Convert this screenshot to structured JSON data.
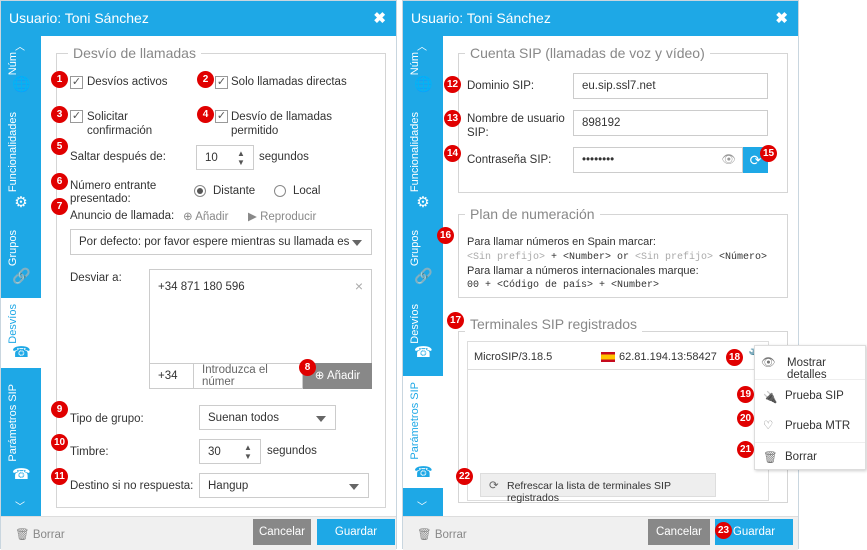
{
  "left": {
    "title": "Usuario: Toni Sánchez",
    "tabs": [
      "Núm",
      "Funcionalidades",
      "Grupos",
      "Desvíos",
      "Parámetros SIP"
    ],
    "legend": "Desvío de llamadas",
    "desvios_activos": "Desvíos activos",
    "solo_directas": "Solo llamadas directas",
    "solicitar": "Solicitar confirmación",
    "desvio_permitido": "Desvío de llamadas permitido",
    "saltar_label": "Saltar después de:",
    "saltar_value": "10",
    "saltar_unit": "segundos",
    "numero_entrante": "Número entrante presentado:",
    "distante": "Distante",
    "local": "Local",
    "anuncio": "Anuncio de llamada:",
    "anadir": "Añadir",
    "reproducir": "Reproducir",
    "anuncio_select": "Por defecto: por favor espere mientras su llamada est",
    "desviar": "Desviar a:",
    "desviar_item": "+34 871 180 596",
    "prefix": "+34",
    "number_placeholder": "Introduzca el númer",
    "anadir_btn": "Añadir",
    "tipo_label": "Tipo de grupo:",
    "tipo_value": "Suenan todos",
    "timbre_label": "Timbre:",
    "timbre_value": "30",
    "timbre_unit": "segundos",
    "destino_label": "Destino si no respuesta:",
    "destino_value": "Hangup",
    "borrar": "Borrar",
    "cancelar": "Cancelar",
    "guardar": "Guardar"
  },
  "right": {
    "title": "Usuario: Toni Sánchez",
    "tabs": [
      "Núm",
      "Funcionalidades",
      "Grupos",
      "Desvíos",
      "Parámetros SIP"
    ],
    "legend_sip": "Cuenta SIP (llamadas de voz y vídeo)",
    "dominio_label": "Dominio SIP:",
    "dominio_value": "eu.sip.ssl7.net",
    "usuario_label": "Nombre de usuario SIP:",
    "usuario_value": "898192",
    "password_label": "Contraseña SIP:",
    "password_value": "••••••••",
    "legend_plan": "Plan de numeración",
    "plan_line1": "Para llamar números en Spain marcar:",
    "plan_sin1": "<Sin prefijo>",
    "plan_plus": " + <Number> or ",
    "plan_sin2": "<Sin prefijo>",
    "plan_num": " <Número>",
    "plan_line3": "Para llamar a números internacionales marque:",
    "plan_line4": "00 + <Código de país> + <Number>",
    "legend_term": "Terminales SIP registrados",
    "terminal_name": "MicroSIP/3.18.5",
    "terminal_addr": "62.81.194.13:58427",
    "refresh": "Refrescar la lista de terminales SIP registrados",
    "borrar": "Borrar",
    "cancelar": "Cancelar",
    "guardar": "Guardar"
  },
  "menu": {
    "mostrar": "Mostrar detalles",
    "prueba_sip": "Prueba SIP",
    "prueba_mtr": "Prueba MTR",
    "borrar": "Borrar"
  },
  "badges": [
    "1",
    "2",
    "3",
    "4",
    "5",
    "6",
    "7",
    "8",
    "9",
    "10",
    "11",
    "12",
    "13",
    "14",
    "15",
    "16",
    "17",
    "18",
    "19",
    "20",
    "21",
    "22",
    "23"
  ],
  "colors": {
    "accent": "#1ea8e6",
    "badge": "#e00000"
  }
}
